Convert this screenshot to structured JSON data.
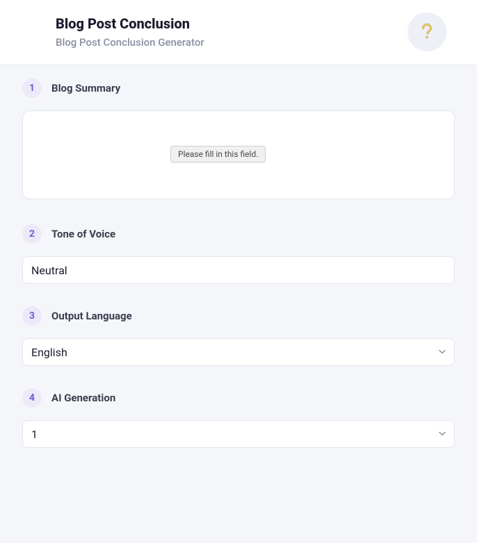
{
  "header": {
    "title": "Blog Post Conclusion",
    "subtitle": "Blog Post Conclusion Generator"
  },
  "sections": {
    "summary": {
      "step": "1",
      "label": "Blog Summary",
      "value": "",
      "tooltip": "Please fill in this field."
    },
    "tone": {
      "step": "2",
      "label": "Tone of Voice",
      "value": "Neutral"
    },
    "language": {
      "step": "3",
      "label": "Output Language",
      "value": "English"
    },
    "generation": {
      "step": "4",
      "label": "AI Generation",
      "value": "1"
    }
  }
}
